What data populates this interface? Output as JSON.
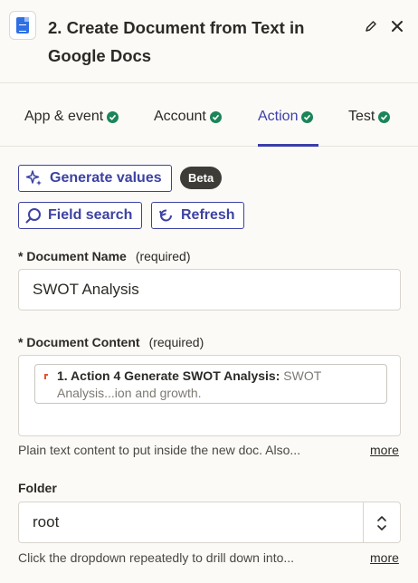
{
  "header": {
    "title_line1": "2. Create Document from Text in",
    "title_line2": "Google Docs",
    "app_icon": "google-docs-icon",
    "edit_icon": "pencil-icon",
    "close_icon": "close-icon"
  },
  "tabs": [
    {
      "label": "App & event",
      "status": "complete",
      "active": false
    },
    {
      "label": "Account",
      "status": "complete",
      "active": false
    },
    {
      "label": "Action",
      "status": "complete",
      "active": true
    },
    {
      "label": "Test",
      "status": "complete",
      "active": false
    }
  ],
  "toolbar": {
    "generate_label": "Generate values",
    "beta_label": "Beta",
    "field_search_label": "Field search",
    "refresh_label": "Refresh"
  },
  "fields": {
    "document_name": {
      "label": "Document Name",
      "required_marker": "*",
      "required_text": "(required)",
      "value": "SWOT Analysis"
    },
    "document_content": {
      "label": "Document Content",
      "required_marker": "*",
      "required_text": "(required)",
      "chip_title": "1. Action 4 Generate SWOT Analysis:",
      "chip_value_start": "SWOT",
      "chip_value_cont": "Analysis...ion and growth.",
      "help": "Plain text content to put inside the new doc. Also...",
      "more": "more"
    },
    "folder": {
      "label": "Folder",
      "value": "root",
      "help": "Click the dropdown repeatedly to drill down into...",
      "more": "more"
    }
  },
  "colors": {
    "accent": "#3b3fa9",
    "success": "#1b8559",
    "background": "#fbfaf7",
    "beta_badge": "#3e3c37"
  }
}
